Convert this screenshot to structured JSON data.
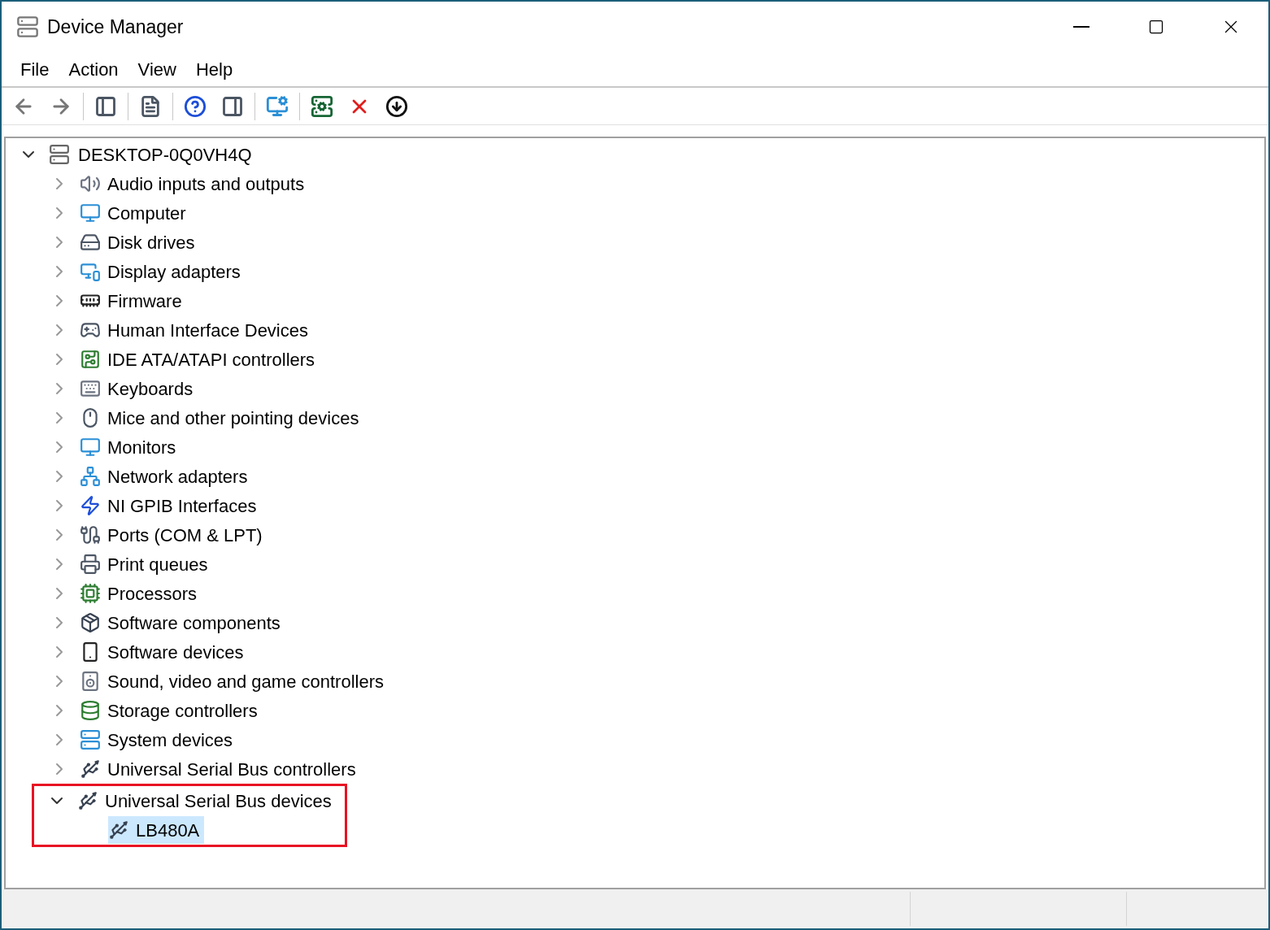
{
  "window": {
    "title": "Device Manager"
  },
  "menu": [
    "File",
    "Action",
    "View",
    "Help"
  ],
  "tree": {
    "label": "DESKTOP-0Q0VH4Q",
    "expanded": true,
    "children": [
      {
        "label": "Audio inputs and outputs",
        "expanded": false
      },
      {
        "label": "Computer",
        "expanded": false
      },
      {
        "label": "Disk drives",
        "expanded": false
      },
      {
        "label": "Display adapters",
        "expanded": false
      },
      {
        "label": "Firmware",
        "expanded": false
      },
      {
        "label": "Human Interface Devices",
        "expanded": false
      },
      {
        "label": "IDE ATA/ATAPI controllers",
        "expanded": false
      },
      {
        "label": "Keyboards",
        "expanded": false
      },
      {
        "label": "Mice and other pointing devices",
        "expanded": false
      },
      {
        "label": "Monitors",
        "expanded": false
      },
      {
        "label": "Network adapters",
        "expanded": false
      },
      {
        "label": "NI GPIB Interfaces",
        "expanded": false
      },
      {
        "label": "Ports (COM & LPT)",
        "expanded": false
      },
      {
        "label": "Print queues",
        "expanded": false
      },
      {
        "label": "Processors",
        "expanded": false
      },
      {
        "label": "Software components",
        "expanded": false
      },
      {
        "label": "Software devices",
        "expanded": false
      },
      {
        "label": "Sound, video and game controllers",
        "expanded": false
      },
      {
        "label": "Storage controllers",
        "expanded": false
      },
      {
        "label": "System devices",
        "expanded": false
      },
      {
        "label": "Universal Serial Bus controllers",
        "expanded": false
      },
      {
        "label": "Universal Serial Bus devices",
        "expanded": true,
        "highlighted": true,
        "children": [
          {
            "label": "LB480A",
            "selected": true
          }
        ]
      }
    ]
  }
}
